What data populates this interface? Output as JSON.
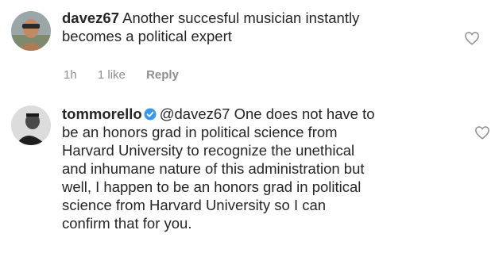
{
  "comments": [
    {
      "username": "davez67",
      "verified": false,
      "mention": "",
      "lines": [
        "Another succesful musician instantly",
        "becomes a political expert"
      ],
      "time": "1h",
      "likes": "1 like",
      "reply_label": "Reply",
      "avatar_icon": "profile-photo"
    },
    {
      "username": "tommorello",
      "verified": true,
      "mention": "@davez67",
      "lines": [
        "One does not have to",
        "be an honors grad in political science from",
        "Harvard University to recognize the unethical",
        "and inhumane nature of this administration but",
        "well, I happen to be an honors grad in political",
        "science from Harvard University so I can",
        "confirm that for you."
      ],
      "avatar_icon": "profile-photo",
      "verified_badge_color": "#3897f0"
    }
  ],
  "icons": {
    "like": "heart-outline-icon",
    "verified": "verified-badge-icon"
  }
}
